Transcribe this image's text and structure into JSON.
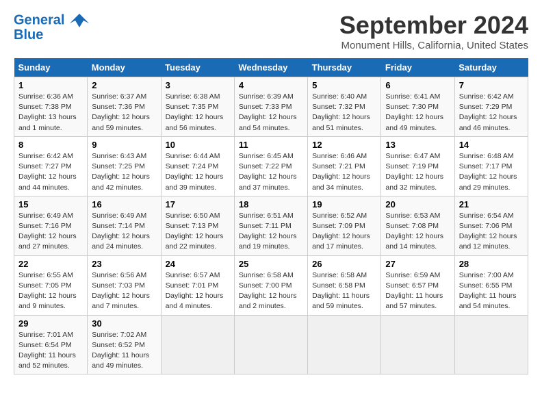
{
  "header": {
    "logo_line1": "General",
    "logo_line2": "Blue",
    "month": "September 2024",
    "location": "Monument Hills, California, United States"
  },
  "weekdays": [
    "Sunday",
    "Monday",
    "Tuesday",
    "Wednesday",
    "Thursday",
    "Friday",
    "Saturday"
  ],
  "weeks": [
    [
      {
        "day": "1",
        "info": "Sunrise: 6:36 AM\nSunset: 7:38 PM\nDaylight: 13 hours\nand 1 minute."
      },
      {
        "day": "2",
        "info": "Sunrise: 6:37 AM\nSunset: 7:36 PM\nDaylight: 12 hours\nand 59 minutes."
      },
      {
        "day": "3",
        "info": "Sunrise: 6:38 AM\nSunset: 7:35 PM\nDaylight: 12 hours\nand 56 minutes."
      },
      {
        "day": "4",
        "info": "Sunrise: 6:39 AM\nSunset: 7:33 PM\nDaylight: 12 hours\nand 54 minutes."
      },
      {
        "day": "5",
        "info": "Sunrise: 6:40 AM\nSunset: 7:32 PM\nDaylight: 12 hours\nand 51 minutes."
      },
      {
        "day": "6",
        "info": "Sunrise: 6:41 AM\nSunset: 7:30 PM\nDaylight: 12 hours\nand 49 minutes."
      },
      {
        "day": "7",
        "info": "Sunrise: 6:42 AM\nSunset: 7:29 PM\nDaylight: 12 hours\nand 46 minutes."
      }
    ],
    [
      {
        "day": "8",
        "info": "Sunrise: 6:42 AM\nSunset: 7:27 PM\nDaylight: 12 hours\nand 44 minutes."
      },
      {
        "day": "9",
        "info": "Sunrise: 6:43 AM\nSunset: 7:25 PM\nDaylight: 12 hours\nand 42 minutes."
      },
      {
        "day": "10",
        "info": "Sunrise: 6:44 AM\nSunset: 7:24 PM\nDaylight: 12 hours\nand 39 minutes."
      },
      {
        "day": "11",
        "info": "Sunrise: 6:45 AM\nSunset: 7:22 PM\nDaylight: 12 hours\nand 37 minutes."
      },
      {
        "day": "12",
        "info": "Sunrise: 6:46 AM\nSunset: 7:21 PM\nDaylight: 12 hours\nand 34 minutes."
      },
      {
        "day": "13",
        "info": "Sunrise: 6:47 AM\nSunset: 7:19 PM\nDaylight: 12 hours\nand 32 minutes."
      },
      {
        "day": "14",
        "info": "Sunrise: 6:48 AM\nSunset: 7:17 PM\nDaylight: 12 hours\nand 29 minutes."
      }
    ],
    [
      {
        "day": "15",
        "info": "Sunrise: 6:49 AM\nSunset: 7:16 PM\nDaylight: 12 hours\nand 27 minutes."
      },
      {
        "day": "16",
        "info": "Sunrise: 6:49 AM\nSunset: 7:14 PM\nDaylight: 12 hours\nand 24 minutes."
      },
      {
        "day": "17",
        "info": "Sunrise: 6:50 AM\nSunset: 7:13 PM\nDaylight: 12 hours\nand 22 minutes."
      },
      {
        "day": "18",
        "info": "Sunrise: 6:51 AM\nSunset: 7:11 PM\nDaylight: 12 hours\nand 19 minutes."
      },
      {
        "day": "19",
        "info": "Sunrise: 6:52 AM\nSunset: 7:09 PM\nDaylight: 12 hours\nand 17 minutes."
      },
      {
        "day": "20",
        "info": "Sunrise: 6:53 AM\nSunset: 7:08 PM\nDaylight: 12 hours\nand 14 minutes."
      },
      {
        "day": "21",
        "info": "Sunrise: 6:54 AM\nSunset: 7:06 PM\nDaylight: 12 hours\nand 12 minutes."
      }
    ],
    [
      {
        "day": "22",
        "info": "Sunrise: 6:55 AM\nSunset: 7:05 PM\nDaylight: 12 hours\nand 9 minutes."
      },
      {
        "day": "23",
        "info": "Sunrise: 6:56 AM\nSunset: 7:03 PM\nDaylight: 12 hours\nand 7 minutes."
      },
      {
        "day": "24",
        "info": "Sunrise: 6:57 AM\nSunset: 7:01 PM\nDaylight: 12 hours\nand 4 minutes."
      },
      {
        "day": "25",
        "info": "Sunrise: 6:58 AM\nSunset: 7:00 PM\nDaylight: 12 hours\nand 2 minutes."
      },
      {
        "day": "26",
        "info": "Sunrise: 6:58 AM\nSunset: 6:58 PM\nDaylight: 11 hours\nand 59 minutes."
      },
      {
        "day": "27",
        "info": "Sunrise: 6:59 AM\nSunset: 6:57 PM\nDaylight: 11 hours\nand 57 minutes."
      },
      {
        "day": "28",
        "info": "Sunrise: 7:00 AM\nSunset: 6:55 PM\nDaylight: 11 hours\nand 54 minutes."
      }
    ],
    [
      {
        "day": "29",
        "info": "Sunrise: 7:01 AM\nSunset: 6:54 PM\nDaylight: 11 hours\nand 52 minutes."
      },
      {
        "day": "30",
        "info": "Sunrise: 7:02 AM\nSunset: 6:52 PM\nDaylight: 11 hours\nand 49 minutes."
      },
      {
        "day": "",
        "info": ""
      },
      {
        "day": "",
        "info": ""
      },
      {
        "day": "",
        "info": ""
      },
      {
        "day": "",
        "info": ""
      },
      {
        "day": "",
        "info": ""
      }
    ]
  ]
}
